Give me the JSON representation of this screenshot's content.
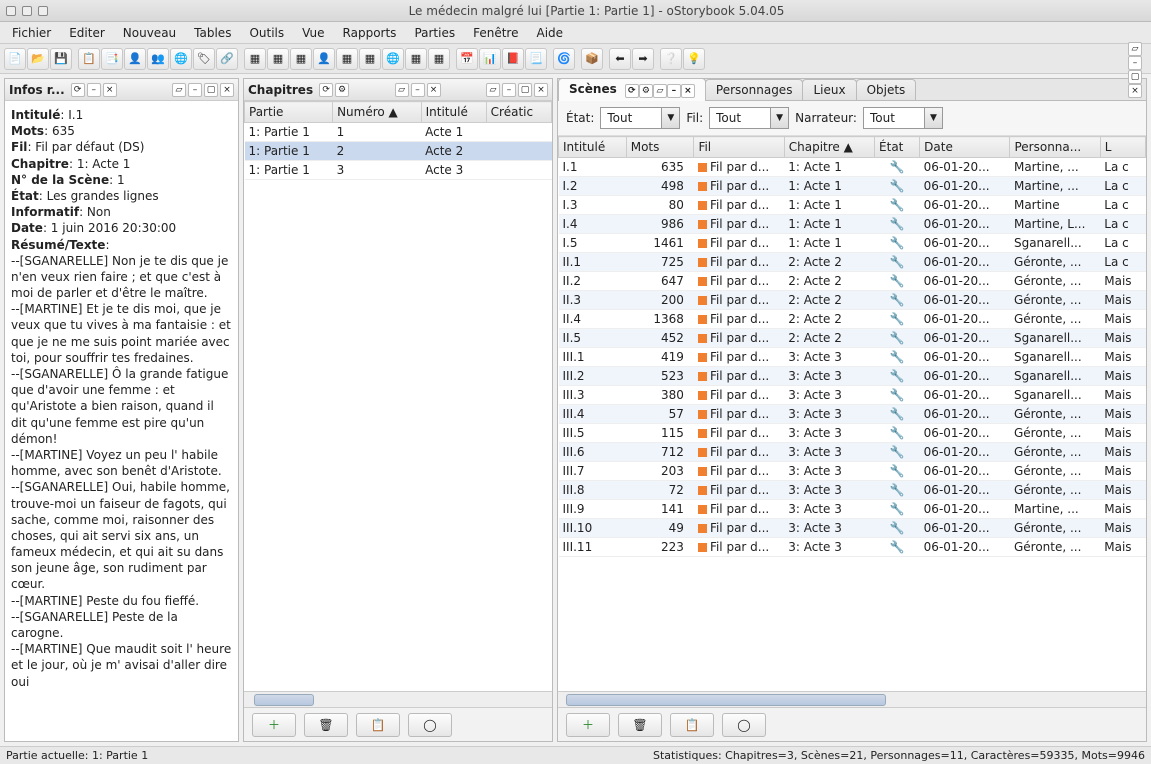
{
  "window": {
    "title": "Le médecin malgré lui [Partie 1: Partie 1] - oStorybook 5.04.05"
  },
  "menu": [
    "Fichier",
    "Editer",
    "Nouveau",
    "Tables",
    "Outils",
    "Vue",
    "Rapports",
    "Parties",
    "Fenêtre",
    "Aide"
  ],
  "info_panel": {
    "title": "Infos r...",
    "fields": {
      "intitule_lbl": "Intitulé",
      "intitule_val": "I.1",
      "mots_lbl": "Mots",
      "mots_val": "635",
      "fil_lbl": "Fil",
      "fil_val": "Fil par défaut (DS)",
      "chapitre_lbl": "Chapitre",
      "chapitre_val": "1: Acte 1",
      "numscene_lbl": "N° de la Scène",
      "numscene_val": "1",
      "etat_lbl": "État",
      "etat_val": "Les grandes lignes",
      "informatif_lbl": "Informatif",
      "informatif_val": "Non",
      "date_lbl": "Date",
      "date_val": "1 juin 2016 20:30:00",
      "resume_lbl": "Résumé/Texte"
    },
    "body": "--[SGANARELLE] Non je te dis que je n'en veux rien faire ; et que c'est à moi de parler et d'être le maître.\n--[MARTINE] Et je te dis moi, que je veux que tu vives à ma fantaisie : et que je ne me suis point mariée avec toi, pour souffrir tes fredaines.\n--[SGANARELLE] Ô la grande fatigue que d'avoir une femme : et qu'Aristote a bien raison, quand il dit qu'une femme est pire qu'un démon!\n--[MARTINE] Voyez un peu l' habile homme, avec son benêt d'Aristote.\n--[SGANARELLE] Oui, habile homme, trouve-moi un faiseur de fagots, qui sache, comme moi, raisonner des choses, qui ait servi six ans, un fameux médecin, et qui ait su dans son jeune âge, son rudiment par cœur.\n--[MARTINE] Peste du fou fieffé.\n--[SGANARELLE] Peste de la carogne.\n--[MARTINE] Que maudit soit l' heure et le jour, où je m' avisai d'aller dire oui"
  },
  "chapters_panel": {
    "title": "Chapitres",
    "columns": [
      "Partie",
      "Numéro ▲",
      "Intitulé",
      "Créatic"
    ],
    "rows": [
      {
        "partie": "1: Partie 1",
        "num": "1",
        "intitule": "Acte 1",
        "sel": false
      },
      {
        "partie": "1: Partie 1",
        "num": "2",
        "intitule": "Acte 2",
        "sel": true
      },
      {
        "partie": "1: Partie 1",
        "num": "3",
        "intitule": "Acte 3",
        "sel": false
      }
    ]
  },
  "scenes_panel": {
    "tabs": [
      "Scènes",
      "Personnages",
      "Lieux",
      "Objets"
    ],
    "filters": {
      "etat_lbl": "État:",
      "etat_val": "Tout",
      "fil_lbl": "Fil:",
      "fil_val": "Tout",
      "narr_lbl": "Narrateur:",
      "narr_val": "Tout"
    },
    "columns": [
      "Intitulé",
      "Mots",
      "Fil",
      "Chapitre ▲",
      "État",
      "Date",
      "Personna...",
      "L"
    ],
    "rows": [
      {
        "i": "I.1",
        "m": "635",
        "f": "Fil par d...",
        "c": "1: Acte 1",
        "d": "06-01-20...",
        "p": "Martine, ...",
        "l": "La c"
      },
      {
        "i": "I.2",
        "m": "498",
        "f": "Fil par d...",
        "c": "1: Acte 1",
        "d": "06-01-20...",
        "p": "Martine, ...",
        "l": "La c"
      },
      {
        "i": "I.3",
        "m": "80",
        "f": "Fil par d...",
        "c": "1: Acte 1",
        "d": "06-01-20...",
        "p": "Martine",
        "l": "La c"
      },
      {
        "i": "I.4",
        "m": "986",
        "f": "Fil par d...",
        "c": "1: Acte 1",
        "d": "06-01-20...",
        "p": "Martine, L...",
        "l": "La c"
      },
      {
        "i": "I.5",
        "m": "1461",
        "f": "Fil par d...",
        "c": "1: Acte 1",
        "d": "06-01-20...",
        "p": "Sganarell...",
        "l": "La c"
      },
      {
        "i": "II.1",
        "m": "725",
        "f": "Fil par d...",
        "c": "2: Acte 2",
        "d": "06-01-20...",
        "p": "Géronte, ...",
        "l": "La c"
      },
      {
        "i": "II.2",
        "m": "647",
        "f": "Fil par d...",
        "c": "2: Acte 2",
        "d": "06-01-20...",
        "p": "Géronte, ...",
        "l": "Mais"
      },
      {
        "i": "II.3",
        "m": "200",
        "f": "Fil par d...",
        "c": "2: Acte 2",
        "d": "06-01-20...",
        "p": "Géronte, ...",
        "l": "Mais"
      },
      {
        "i": "II.4",
        "m": "1368",
        "f": "Fil par d...",
        "c": "2: Acte 2",
        "d": "06-01-20...",
        "p": "Géronte, ...",
        "l": "Mais"
      },
      {
        "i": "II.5",
        "m": "452",
        "f": "Fil par d...",
        "c": "2: Acte 2",
        "d": "06-01-20...",
        "p": "Sganarell...",
        "l": "Mais"
      },
      {
        "i": "III.1",
        "m": "419",
        "f": "Fil par d...",
        "c": "3: Acte 3",
        "d": "06-01-20...",
        "p": "Sganarell...",
        "l": "Mais"
      },
      {
        "i": "III.2",
        "m": "523",
        "f": "Fil par d...",
        "c": "3: Acte 3",
        "d": "06-01-20...",
        "p": "Sganarell...",
        "l": "Mais"
      },
      {
        "i": "III.3",
        "m": "380",
        "f": "Fil par d...",
        "c": "3: Acte 3",
        "d": "06-01-20...",
        "p": "Sganarell...",
        "l": "Mais"
      },
      {
        "i": "III.4",
        "m": "57",
        "f": "Fil par d...",
        "c": "3: Acte 3",
        "d": "06-01-20...",
        "p": "Géronte, ...",
        "l": "Mais"
      },
      {
        "i": "III.5",
        "m": "115",
        "f": "Fil par d...",
        "c": "3: Acte 3",
        "d": "06-01-20...",
        "p": "Géronte, ...",
        "l": "Mais"
      },
      {
        "i": "III.6",
        "m": "712",
        "f": "Fil par d...",
        "c": "3: Acte 3",
        "d": "06-01-20...",
        "p": "Géronte, ...",
        "l": "Mais"
      },
      {
        "i": "III.7",
        "m": "203",
        "f": "Fil par d...",
        "c": "3: Acte 3",
        "d": "06-01-20...",
        "p": "Géronte, ...",
        "l": "Mais"
      },
      {
        "i": "III.8",
        "m": "72",
        "f": "Fil par d...",
        "c": "3: Acte 3",
        "d": "06-01-20...",
        "p": "Géronte, ...",
        "l": "Mais"
      },
      {
        "i": "III.9",
        "m": "141",
        "f": "Fil par d...",
        "c": "3: Acte 3",
        "d": "06-01-20...",
        "p": "Martine, ...",
        "l": "Mais"
      },
      {
        "i": "III.10",
        "m": "49",
        "f": "Fil par d...",
        "c": "3: Acte 3",
        "d": "06-01-20...",
        "p": "Géronte, ...",
        "l": "Mais"
      },
      {
        "i": "III.11",
        "m": "223",
        "f": "Fil par d...",
        "c": "3: Acte 3",
        "d": "06-01-20...",
        "p": "Géronte, ...",
        "l": "Mais"
      }
    ]
  },
  "status": {
    "left": "Partie actuelle: 1: Partie 1",
    "right": "Statistiques: Chapitres=3,  Scènes=21,  Personnages=11,  Caractères=59335,  Mots=9946"
  }
}
